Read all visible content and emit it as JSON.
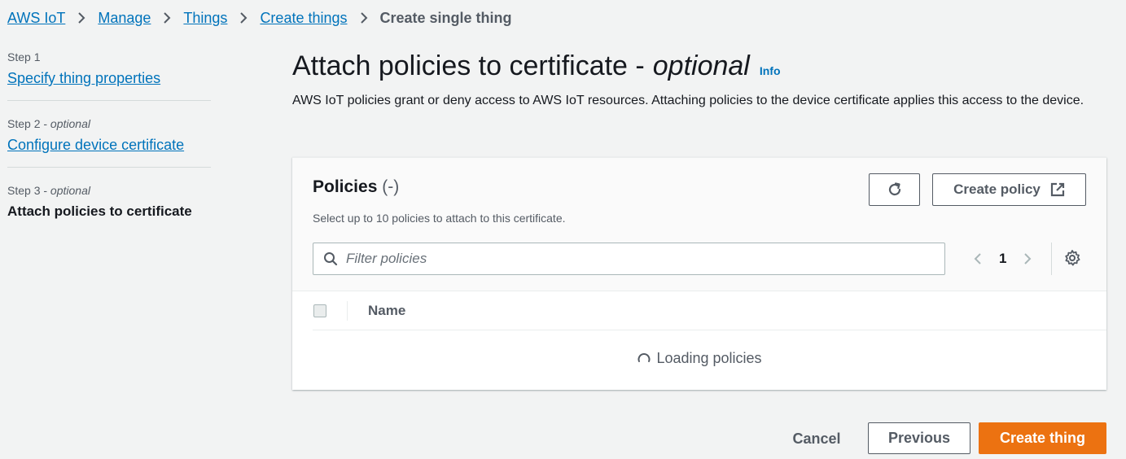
{
  "breadcrumb": {
    "items": [
      "AWS IoT",
      "Manage",
      "Things",
      "Create things"
    ],
    "current": "Create single thing"
  },
  "steps": [
    {
      "number": "Step 1",
      "optional": "",
      "label": "Specify thing properties"
    },
    {
      "number": "Step 2 - ",
      "optional": "optional",
      "label": "Configure device certificate"
    },
    {
      "number": "Step 3 - ",
      "optional": "optional",
      "label": "Attach policies to certificate"
    }
  ],
  "header": {
    "title": "Attach policies to certificate -",
    "title_optional": "optional",
    "info": "Info",
    "description": "AWS IoT policies grant or deny access to AWS IoT resources. Attaching policies to the device certificate applies this access to the device."
  },
  "policies": {
    "title": "Policies",
    "count": "(-)",
    "description": "Select up to 10 policies to attach to this certificate.",
    "create_policy_label": "Create policy",
    "filter_placeholder": "Filter policies",
    "page": "1",
    "column_name": "Name",
    "loading_text": "Loading policies"
  },
  "footer": {
    "cancel": "Cancel",
    "previous": "Previous",
    "create": "Create thing"
  },
  "colors": {
    "link": "#0073bb",
    "primary_button": "#ec7211",
    "background": "#f2f3f3"
  }
}
